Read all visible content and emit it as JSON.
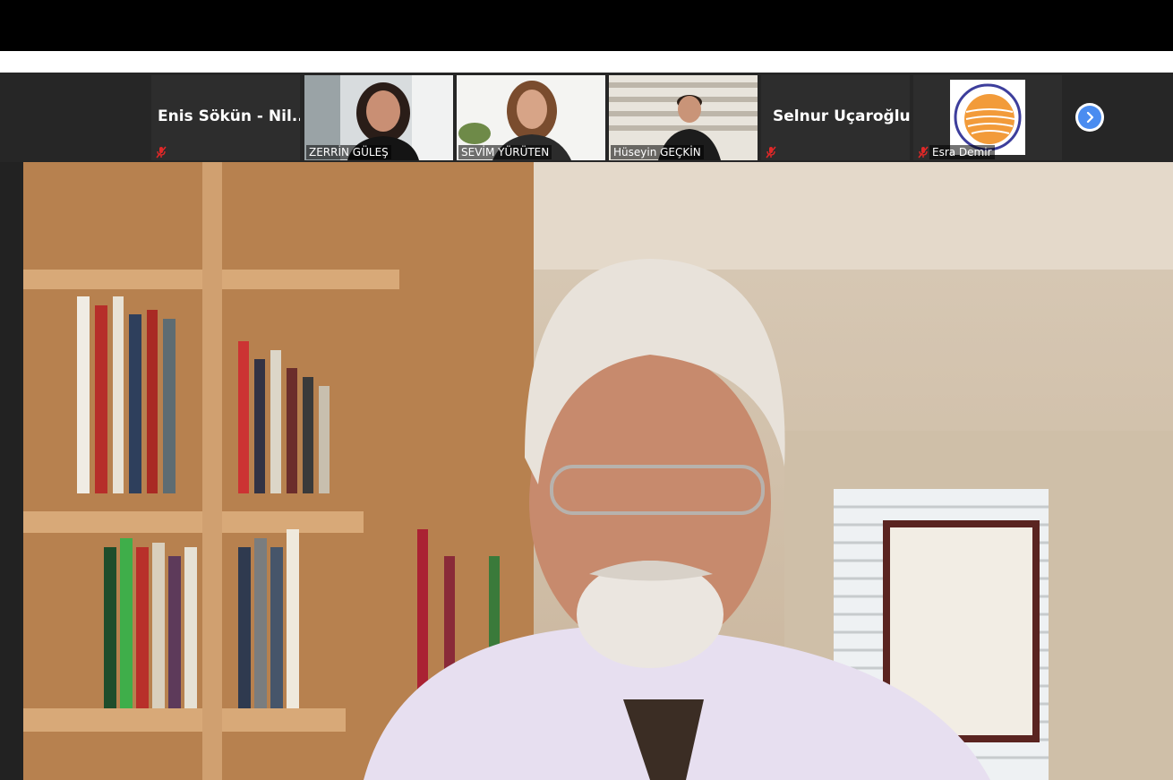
{
  "participants": [
    {
      "name": "Enis Sökün - Nil...",
      "video": false,
      "muted": true
    },
    {
      "name": "ZERRİN GÜLEŞ",
      "video": true,
      "muted": false
    },
    {
      "name": "SEVİM YÜRÜTEN",
      "video": true,
      "muted": false
    },
    {
      "name": "Hüseyin GEÇKİN",
      "video": true,
      "muted": false
    },
    {
      "name": "Selnur Uçaroğlu",
      "video": false,
      "muted": true
    },
    {
      "name": "Esra Demir",
      "video": false,
      "muted": true,
      "avatar": "logo"
    }
  ],
  "icons": {
    "next": "chevron-right-icon",
    "muted": "mic-muted-icon"
  },
  "colors": {
    "muted_red": "#e02828",
    "next_blue": "#4a8cf0",
    "strip_bg": "#262626"
  }
}
